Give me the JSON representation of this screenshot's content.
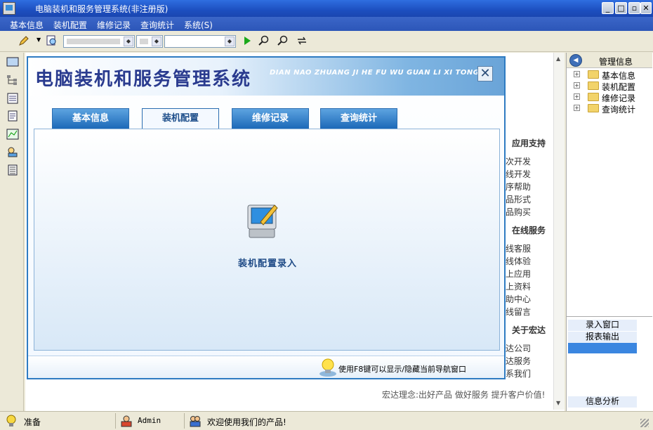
{
  "window": {
    "title": "电脑装机和服务管理系统(非注册版)"
  },
  "menu": [
    "基本信息",
    "装机配置",
    "维修记录",
    "查询统计",
    "系统(S)"
  ],
  "dialog": {
    "title": "电脑装机和服务管理系统",
    "subtitle": "DIAN NAO ZHUANG JI HE FU WU GUAN LI XI TONG",
    "close": "✕",
    "tabs": [
      "基本信息",
      "装机配置",
      "维修记录",
      "查询统计"
    ],
    "active_tab": "装机配置",
    "center_label": "装机配置录入",
    "footer_hint": "使用F8键可以显示/隐藏当前导航窗口"
  },
  "side_content": {
    "sections": [
      {
        "head": "应用支持",
        "items": [
          "次开发",
          "线开发",
          "序帮助",
          "品形式",
          "品购买"
        ]
      },
      {
        "head": "在线服务",
        "items": [
          "线客服",
          "线体验",
          "上应用",
          "上资料",
          "助中心",
          "线留言"
        ]
      },
      {
        "head": "关于宏达",
        "items": [
          "达公司",
          "达服务",
          "系我们"
        ]
      }
    ],
    "slogan": "宏达理念:出好产品 做好服务 提升客户价值!"
  },
  "right_panel": {
    "header": "管理信息",
    "tree": [
      "基本信息",
      "装机配置",
      "维修记录",
      "查询统计"
    ],
    "buttons": [
      "录入窗口",
      "报表输出"
    ],
    "bottom_button": "信息分析"
  },
  "status": {
    "ready": "准备",
    "user": "Admin",
    "welcome": "欢迎使用我们的产品!"
  }
}
